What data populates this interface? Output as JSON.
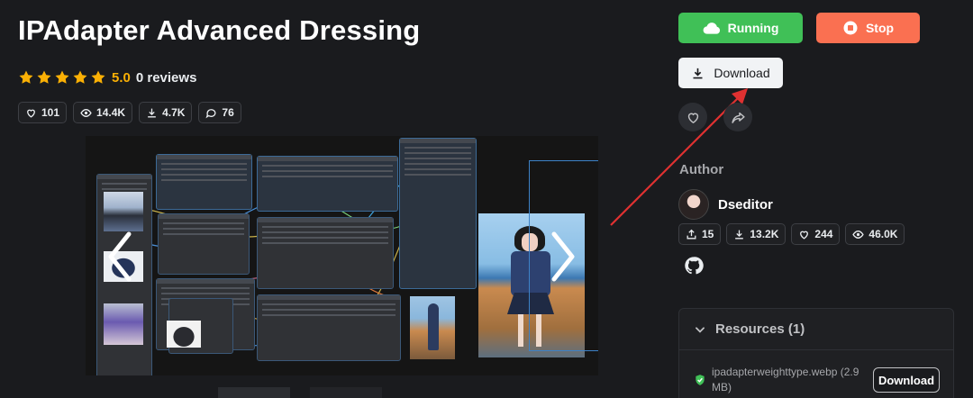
{
  "page": {
    "title": "IPAdapter Advanced Dressing"
  },
  "rating": {
    "stars": 5,
    "value": "5.0",
    "reviews_label": "0 reviews",
    "star_color": "#fab005"
  },
  "stats": {
    "likes": "101",
    "views": "14.4K",
    "downloads": "4.7K",
    "comments": "76"
  },
  "actions": {
    "running_label": "Running",
    "stop_label": "Stop",
    "download_label": "Download",
    "running_color": "#40c057",
    "stop_color": "#fa7051"
  },
  "author": {
    "section_label": "Author",
    "name": "Dseditor",
    "stats": {
      "uploads": "15",
      "downloads": "13.2K",
      "likes": "244",
      "views": "46.0K"
    }
  },
  "resources": {
    "header": "Resources (1)",
    "items": [
      {
        "filename": "ipadapterweighttype.webp (2.9 MB)",
        "download_label": "Download"
      }
    ]
  },
  "icons": {
    "cloud": "cloud-icon",
    "stop": "stop-circle-icon",
    "download": "download-icon",
    "heart": "heart-icon",
    "share": "share-icon",
    "github": "github-icon",
    "check": "check-shield-icon"
  }
}
